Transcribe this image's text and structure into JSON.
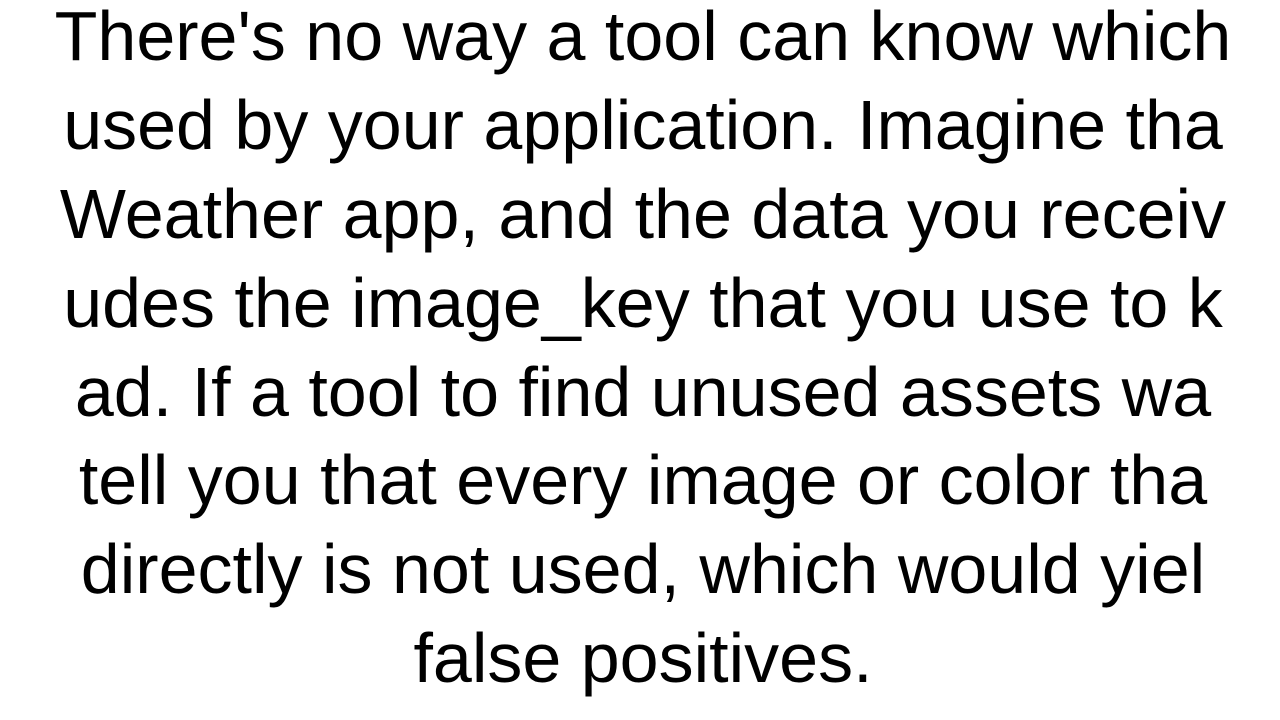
{
  "document": {
    "paragraph": "There's no way a tool can know which\nused by your application. Imagine tha\nWeather app, and the data you receiv\nudes the image_key that you use to k\nad. If a tool to find unused assets wa\ntell you that every image or color tha\ndirectly is not used, which would yiel\nfalse positives."
  }
}
